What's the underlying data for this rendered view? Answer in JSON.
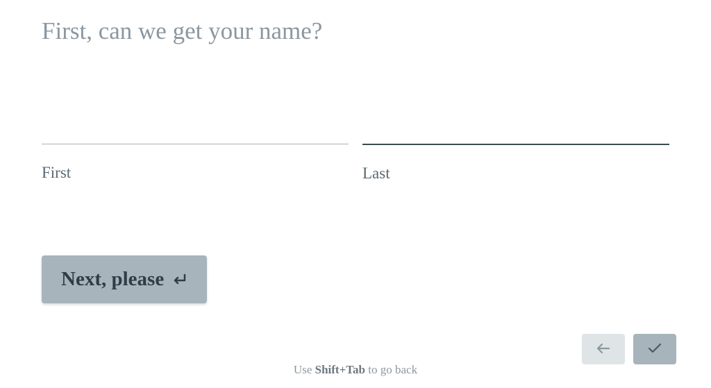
{
  "question": "First, can we get your name?",
  "fields": {
    "first": {
      "label": "First",
      "value": ""
    },
    "last": {
      "label": "Last",
      "value": ""
    }
  },
  "buttons": {
    "next_label": "Next, please"
  },
  "hint": {
    "prefix": "Use ",
    "keys": "Shift+Tab",
    "suffix": " to go back"
  }
}
